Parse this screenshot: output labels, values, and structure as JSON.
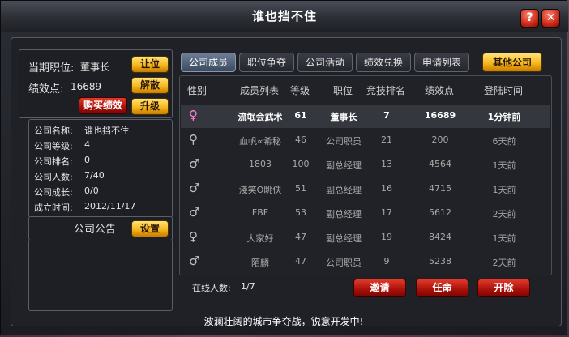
{
  "window": {
    "title": "谁也挡不住",
    "help_label": "?",
    "close_label": "✕"
  },
  "left": {
    "position_label": "当期职位:",
    "position_value": "董事长",
    "perf_label": "绩效点:",
    "perf_value": "16689",
    "btn_resign": "让位",
    "btn_disband": "解散",
    "btn_buy_perf": "购买绩效",
    "btn_upgrade": "升级",
    "info": [
      {
        "label": "公司名称:",
        "value": "谁也挡不住"
      },
      {
        "label": "公司等级:",
        "value": "4"
      },
      {
        "label": "公司排名:",
        "value": "0"
      },
      {
        "label": "公司人数:",
        "value": "7/40"
      },
      {
        "label": "公司成长:",
        "value": "0/0"
      },
      {
        "label": "成立时间:",
        "value": "2012/11/17"
      }
    ],
    "notice_label": "公司公告",
    "btn_settings": "设置"
  },
  "tabs": [
    "公司成员",
    "职位争夺",
    "公司活动",
    "绩效兑换",
    "申请列表",
    "其他公司"
  ],
  "table": {
    "headers": [
      "性别",
      "成员列表",
      "等级",
      "职位",
      "竞技排名",
      "绩效点",
      "登陆时间"
    ],
    "rows": [
      {
        "sex": "♀",
        "name": "流氓会武术",
        "level": "61",
        "role": "董事长",
        "rank": "7",
        "perf": "16689",
        "login": "1分钟前"
      },
      {
        "sex": "♀",
        "name": "血帆∝希秘",
        "level": "46",
        "role": "公司职员",
        "rank": "21",
        "perf": "200",
        "login": "6天前"
      },
      {
        "sex": "♂",
        "name": "1803",
        "level": "100",
        "role": "副总经理",
        "rank": "13",
        "perf": "4564",
        "login": "1天前"
      },
      {
        "sex": "♂",
        "name": "淺笑O眺佚",
        "level": "51",
        "role": "副总经理",
        "rank": "16",
        "perf": "4715",
        "login": "1天前"
      },
      {
        "sex": "♂",
        "name": "FBF",
        "level": "53",
        "role": "副总经理",
        "rank": "17",
        "perf": "5612",
        "login": "2天前"
      },
      {
        "sex": "♀",
        "name": "大家好",
        "level": "47",
        "role": "副总经理",
        "rank": "19",
        "perf": "8424",
        "login": "1天前"
      },
      {
        "sex": "♂",
        "name": "陌麟",
        "level": "47",
        "role": "公司职员",
        "rank": "9",
        "perf": "5238",
        "login": "2天前"
      }
    ]
  },
  "online": {
    "label": "在线人数:",
    "value": "1/7"
  },
  "actions": {
    "invite": "邀请",
    "appoint": "任命",
    "dismiss": "开除"
  },
  "footer_text": "波澜壮阔的城市争夺战，锐意开发中!"
}
